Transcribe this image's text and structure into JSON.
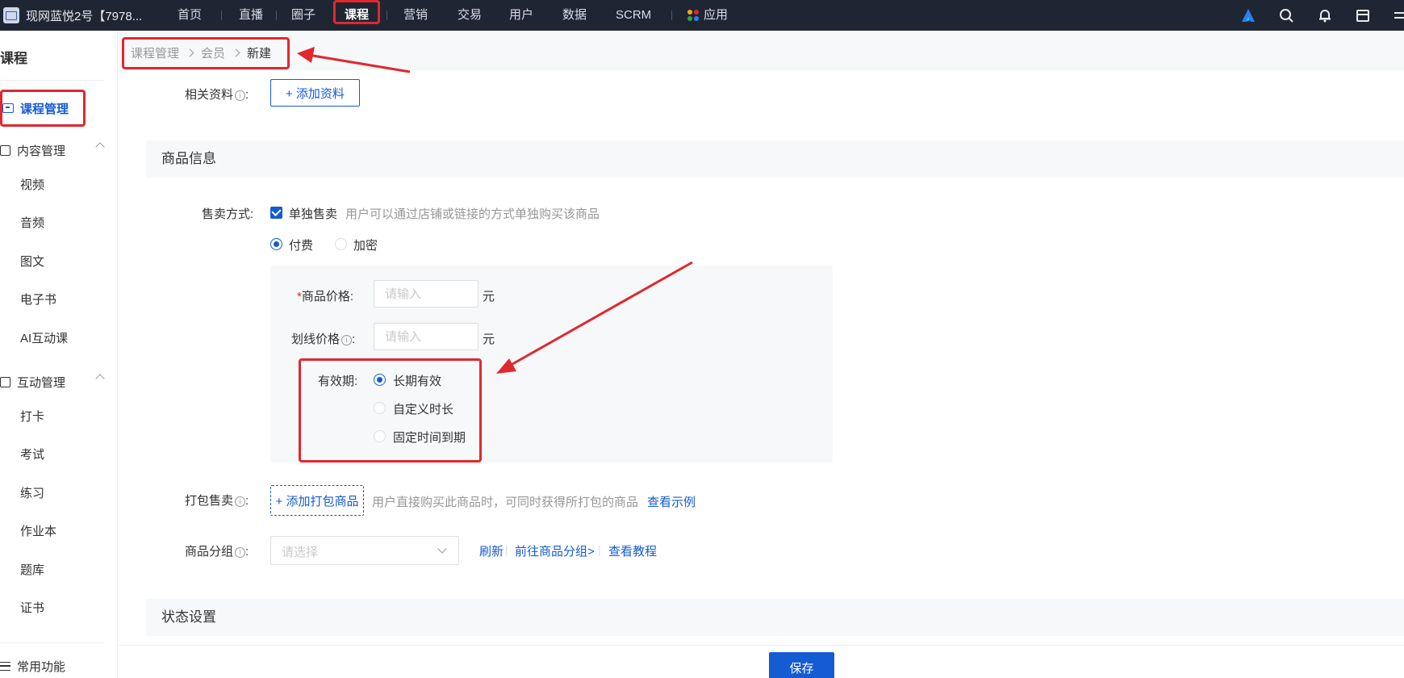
{
  "topnav": {
    "shop_name": "现网蓝悦2号【7978...",
    "items": [
      "首页",
      "直播",
      "圈子",
      "课程",
      "营销",
      "交易",
      "用户",
      "数据",
      "SCRM",
      "应用"
    ],
    "active": "课程"
  },
  "sidebar": {
    "title": "课程",
    "active_item": "课程管理",
    "group_content": "内容管理",
    "content_items": [
      "视频",
      "音频",
      "图文",
      "电子书",
      "AI互动课"
    ],
    "group_interact": "互动管理",
    "interact_items": [
      "打卡",
      "考试",
      "练习",
      "作业本",
      "题库",
      "证书"
    ],
    "bottom": "常用功能"
  },
  "breadcrumb": {
    "items": [
      "课程管理",
      "会员",
      "新建"
    ]
  },
  "form": {
    "related_label": "相关资料",
    "add_material": "+ 添加资料",
    "section_goods": "商品信息",
    "sale_label": "售卖方式:",
    "single_sale": "单独售卖",
    "single_sale_hint": "用户可以通过店铺或链接的方式单独购买该商品",
    "pay_option": "付费",
    "encrypt_option": "加密",
    "price_label": "商品价格:",
    "price_placeholder": "请输入",
    "unit": "元",
    "strike_label": "划线价格",
    "strike_placeholder": "请输入",
    "validity_label": "有效期:",
    "validity_options": [
      "长期有效",
      "自定义时长",
      "固定时间到期"
    ],
    "validity_selected": "长期有效",
    "bundle_label": "打包售卖",
    "bundle_button": "+ 添加打包商品",
    "bundle_hint": "用户直接购买此商品时，可同时获得所打包的商品",
    "bundle_example": "查看示例",
    "group_label": "商品分组",
    "group_placeholder": "请选择",
    "group_links": [
      "刷新",
      "前往商品分组>",
      "查看教程"
    ],
    "section_status": "状态设置"
  },
  "footer": {
    "save": "保存"
  },
  "colors": {
    "nav_bg": "#1f2633",
    "primary": "#155bd4",
    "annotation_red": "#e0282e",
    "section_bg": "#f7f8fa"
  }
}
